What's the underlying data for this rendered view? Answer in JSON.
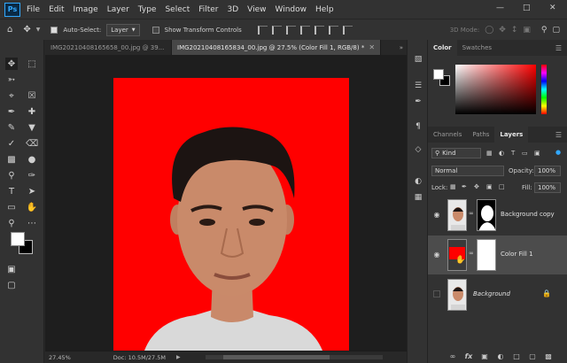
{
  "app": {
    "logo": "Ps"
  },
  "menu": [
    "File",
    "Edit",
    "Image",
    "Layer",
    "Type",
    "Select",
    "Filter",
    "3D",
    "View",
    "Window",
    "Help"
  ],
  "options_bar": {
    "auto_select_label": "Auto-Select:",
    "auto_select_target": "Layer",
    "show_transform_label": "Show Transform Controls",
    "mode_3d": "3D Mode:"
  },
  "tabs": [
    {
      "label": "IMG20210408165658_00.jpg @ 39..."
    },
    {
      "label": "IMG20210408165834_00.jpg @ 27.5% (Color Fill 1, RGB/8) *"
    }
  ],
  "status": {
    "zoom": "27.45%",
    "doc": "Doc: 10.5M/27.5M"
  },
  "color_panel": {
    "tabs": [
      "Color",
      "Swatches"
    ]
  },
  "layers_panel": {
    "tabs": [
      "Channels",
      "Paths",
      "Layers"
    ],
    "filter_kind": "Kind",
    "blend_mode": "Normal",
    "opacity_label": "Opacity:",
    "opacity_value": "100%",
    "lock_label": "Lock:",
    "fill_label": "Fill:",
    "fill_value": "100%",
    "layers": [
      {
        "name": "Background copy"
      },
      {
        "name": "Color Fill 1"
      },
      {
        "name": "Background"
      }
    ]
  },
  "colors": {
    "fill_red": "#ff0000",
    "ps_blue": "#31a8ff",
    "panel_bg": "#323232"
  },
  "icons": {
    "footer": [
      "link-icon",
      "fx-icon",
      "mask-icon",
      "adjustment-icon",
      "folder-icon",
      "new-layer-icon",
      "trash-icon"
    ]
  }
}
